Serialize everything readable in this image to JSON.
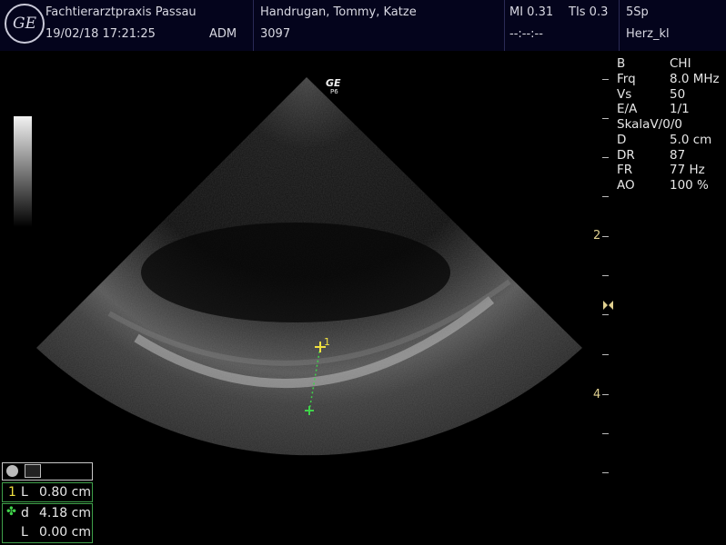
{
  "header": {
    "logo_text": "GE",
    "clinic": "Fachtierarztpraxis Passau",
    "datetime": "19/02/18 17:21:25",
    "operator": "ADM",
    "patient": "Handrugan, Tommy, Katze",
    "patient_id": "3097",
    "mi": "MI 0.31",
    "tis": "TIs 0.3",
    "probe": "5Sp",
    "timer": "--:--:--",
    "preset": "Herz_kl"
  },
  "probe_mark": {
    "brand": "GE",
    "sub": "P6"
  },
  "params": [
    {
      "k": "B",
      "v": "CHI"
    },
    {
      "k": "Frq",
      "v": "8.0 MHz"
    },
    {
      "k": "Vs",
      "v": "50"
    },
    {
      "k": "E/A",
      "v": "1/1"
    },
    {
      "k": "SkalaV/0/0",
      "v": ""
    },
    {
      "k": "D",
      "v": "5.0 cm"
    },
    {
      "k": "DR",
      "v": "87"
    },
    {
      "k": "FR",
      "v": "77 Hz"
    },
    {
      "k": "AO",
      "v": "100 %"
    }
  ],
  "depth_labels": {
    "d2": "2",
    "d4": "4"
  },
  "measurements": {
    "cursor_label": "1",
    "m1_index": "1",
    "m1_type": "L",
    "m1_value": "0.80 cm",
    "d_type": "d",
    "d_value": "4.18 cm",
    "l_type": "L",
    "l_value": "0.00 cm"
  },
  "colors": {
    "caliper_green": "#3fd24a",
    "caliper_yellow": "#f0e040",
    "header_bg": "#04041c"
  }
}
